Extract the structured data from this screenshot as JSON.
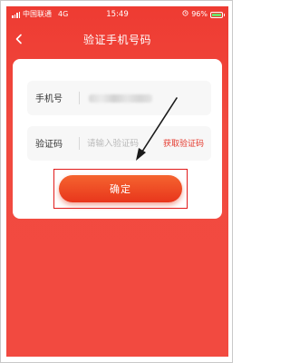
{
  "statusbar": {
    "carrier": "中国联通",
    "network": "4G",
    "time": "15:49",
    "battery": "96%"
  },
  "navbar": {
    "title": "验证手机号码"
  },
  "form": {
    "phone_label": "手机号",
    "code_label": "验证码",
    "code_placeholder": "请输入验证码",
    "get_code_label": "获取验证码",
    "confirm_label": "确定"
  },
  "colors": {
    "background": "#f04a3f",
    "accent": "#e53a2e",
    "annotation": "#e21b1b"
  },
  "icons": [
    "signal-icon",
    "chevron-left-icon",
    "alarm-icon",
    "battery-icon"
  ]
}
